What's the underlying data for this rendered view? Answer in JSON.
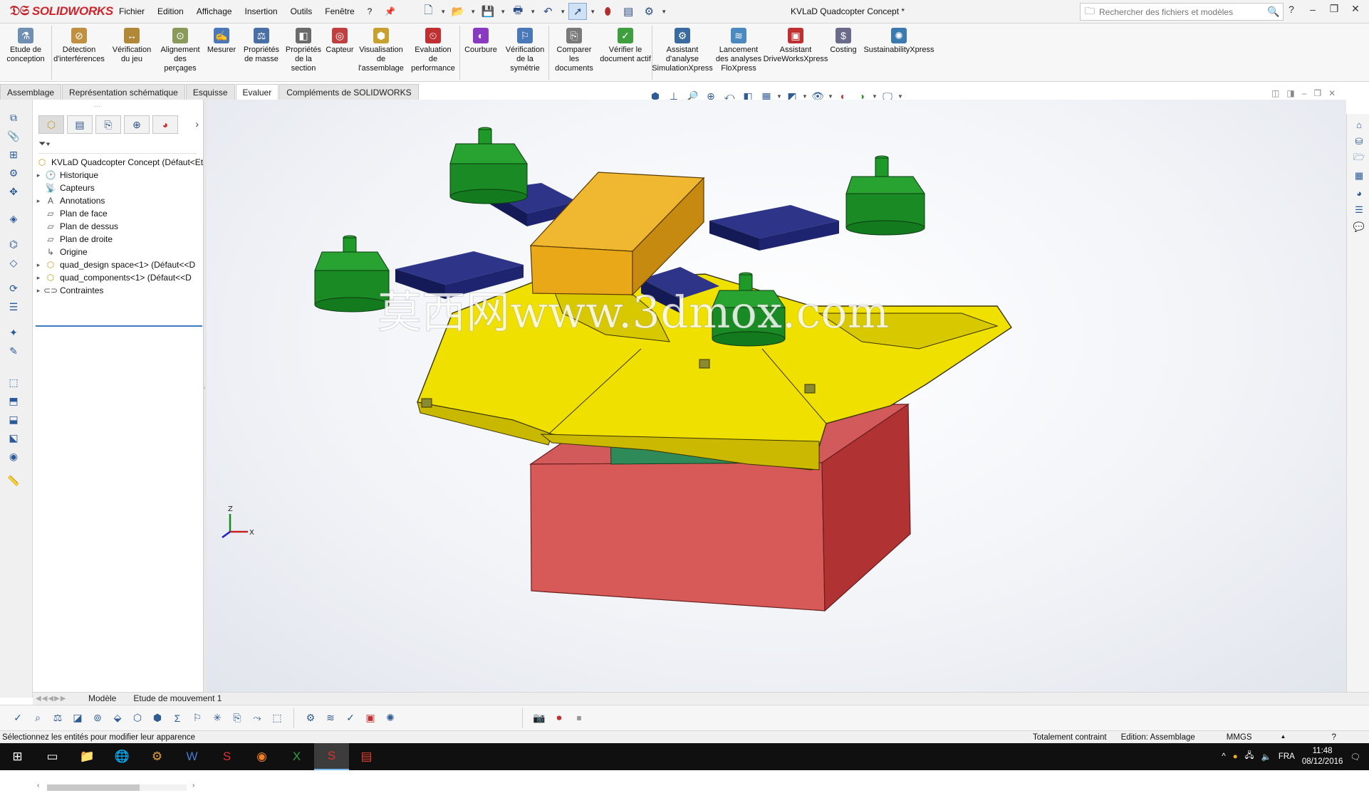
{
  "app": {
    "logo_text": "SOLIDWORKS",
    "document_title": "KVLaD Quadcopter Concept *",
    "menu": [
      "Fichier",
      "Edition",
      "Affichage",
      "Insertion",
      "Outils",
      "Fenêtre",
      "?"
    ],
    "search_placeholder": "Rechercher des fichiers et modèles"
  },
  "ribbon": {
    "commands": [
      {
        "label": "Etude de\nconception",
        "icon": "design-study-icon",
        "color": "#6f8fb3"
      },
      {
        "label": "Détection\nd'interférences",
        "icon": "interference-detection-icon",
        "color": "#c09040"
      },
      {
        "label": "Vérification\ndu jeu",
        "icon": "clearance-verification-icon",
        "color": "#b08838"
      },
      {
        "label": "Alignement\ndes\nperçages",
        "icon": "hole-alignment-icon",
        "color": "#8a9a5a"
      },
      {
        "label": "Mesurer",
        "icon": "measure-icon",
        "color": "#4a78b8"
      },
      {
        "label": "Propriétés\nde masse",
        "icon": "mass-properties-icon",
        "color": "#4a6fa5"
      },
      {
        "label": "Propriétés\nde la\nsection",
        "icon": "section-properties-icon",
        "color": "#6b6b6b"
      },
      {
        "label": "Capteur",
        "icon": "sensor-icon",
        "color": "#c04040"
      },
      {
        "label": "Visualisation\nde\nl'assemblage",
        "icon": "assembly-visualization-icon",
        "color": "#c8a030"
      },
      {
        "label": "Evaluation\nde\nperformance",
        "icon": "performance-evaluation-icon",
        "color": "#c03030"
      },
      {
        "label": "Courbure",
        "icon": "curvature-icon",
        "color": "#8a3ac0"
      },
      {
        "label": "Vérification\nde la\nsymétrie",
        "icon": "symmetry-check-icon",
        "color": "#4a78b8"
      },
      {
        "label": "Comparer\nles\ndocuments",
        "icon": "compare-documents-icon",
        "color": "#7a7a7a"
      },
      {
        "label": "Vérifier le\ndocument actif",
        "icon": "check-active-document-icon",
        "color": "#3f9f3f"
      },
      {
        "label": "Assistant\nd'analyse\nSimulationXpress",
        "icon": "simulationxpress-icon",
        "color": "#3a6aa0"
      },
      {
        "label": "Lancement\ndes analyses\nFloXpress",
        "icon": "floxpress-icon",
        "color": "#4a8ac0"
      },
      {
        "label": "Assistant\nDriveWorksXpress",
        "icon": "driveworksxpress-icon",
        "color": "#c03030"
      },
      {
        "label": "Costing",
        "icon": "costing-icon",
        "color": "#6a6a8a"
      },
      {
        "label": "SustainabilityXpress",
        "icon": "sustainabilityxpress-icon",
        "color": "#3a7ab0"
      }
    ],
    "tabs": [
      {
        "label": "Assemblage",
        "active": false
      },
      {
        "label": "Représentation schématique",
        "active": false
      },
      {
        "label": "Esquisse",
        "active": false
      },
      {
        "label": "Evaluer",
        "active": true
      },
      {
        "label": "Compléments de SOLIDWORKS",
        "active": false
      }
    ]
  },
  "feature_tree": {
    "root": "KVLaD Quadcopter Concept  (Défaut<Et",
    "items": [
      {
        "label": "Historique",
        "icon": "history-folder-icon",
        "expandable": true
      },
      {
        "label": "Capteurs",
        "icon": "sensors-folder-icon",
        "expandable": false
      },
      {
        "label": "Annotations",
        "icon": "annotations-icon",
        "expandable": true
      },
      {
        "label": "Plan de face",
        "icon": "plane-icon",
        "expandable": false
      },
      {
        "label": "Plan de dessus",
        "icon": "plane-icon",
        "expandable": false
      },
      {
        "label": "Plan de droite",
        "icon": "plane-icon",
        "expandable": false
      },
      {
        "label": "Origine",
        "icon": "origin-icon",
        "expandable": false
      },
      {
        "label": "quad_design space<1> (Défaut<<D",
        "icon": "subassembly-icon",
        "expandable": true
      },
      {
        "label": "quad_components<1> (Défaut<<D",
        "icon": "subassembly-icon",
        "expandable": true
      },
      {
        "label": "Contraintes",
        "icon": "mates-icon",
        "expandable": true
      }
    ]
  },
  "model_tabs": [
    {
      "label": "Modèle",
      "active": true
    },
    {
      "label": "Etude de mouvement 1",
      "active": false
    }
  ],
  "watermark": "莫西网www.3dmox.com",
  "triad": {
    "z": "Z",
    "x": "X"
  },
  "status": {
    "message": "Sélectionnez les entités pour modifier leur apparence",
    "constraint": "Totalement contraint",
    "mode": "Edition: Assemblage",
    "units": "MMGS"
  },
  "taskbar": {
    "language": "FRA",
    "time": "11:48",
    "date": "08/12/2016"
  },
  "colors": {
    "frame_yellow": "#f0e000",
    "motor_green": "#1fa028",
    "battery_orange": "#e8a818",
    "pad_navy": "#1c2474",
    "base_red": "#cc4444",
    "accent_blue": "#3a78c2"
  }
}
